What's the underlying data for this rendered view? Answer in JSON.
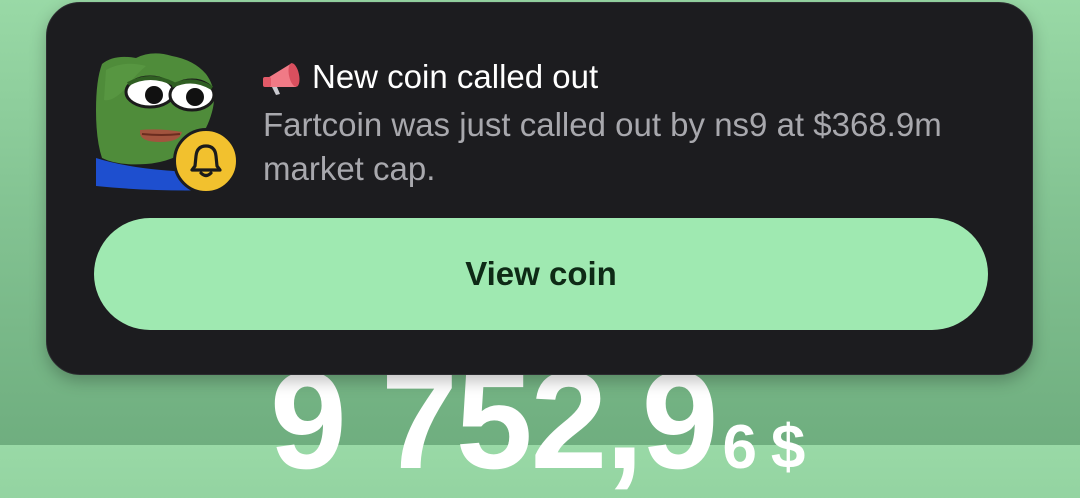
{
  "balance": {
    "main": "9 752,9",
    "cents": "6",
    "currency": "$"
  },
  "notification": {
    "title": "New coin called out",
    "body": "Fartcoin was just called out by ns9 at $368.9m market cap.",
    "button_label": "View coin",
    "icons": {
      "title": "megaphone-icon",
      "avatar": "frog-avatar",
      "badge": "bell-icon"
    },
    "colors": {
      "card_background": "#1c1c1f",
      "button_background": "#9fe9b1",
      "badge": "#f2c12e",
      "page_background": "#84c493"
    }
  }
}
